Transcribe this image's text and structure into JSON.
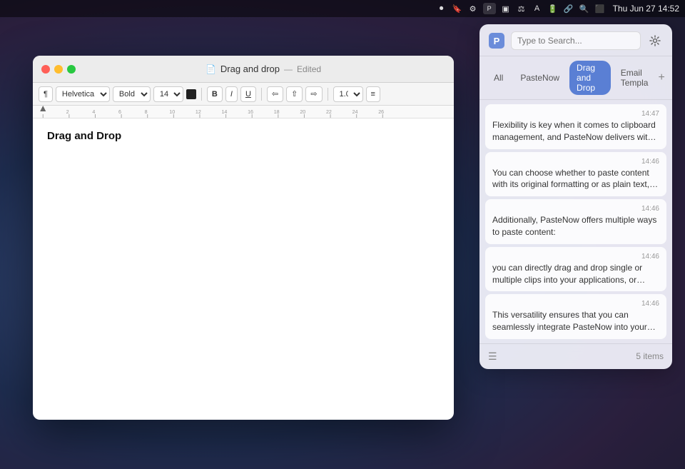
{
  "menubar": {
    "time": "Thu Jun 27  14:52",
    "icons": [
      "record",
      "bookmark",
      "gear",
      "paste-app",
      "media",
      "equalizer",
      "text",
      "battery",
      "link",
      "search",
      "airplay"
    ]
  },
  "editor": {
    "title": "Drag and drop",
    "separator": "—",
    "edited_label": "Edited",
    "heading": "Drag and Drop",
    "toolbar": {
      "paragraph_label": "¶",
      "font_name": "Helvetica",
      "font_weight": "Bold",
      "font_size": "14",
      "color_label": "",
      "bold": "B",
      "italic": "I",
      "underline": "U",
      "align_left": "≡",
      "align_center": "≡",
      "align_right": "≡",
      "line_spacing": "1.0",
      "list": "≡"
    }
  },
  "paste_panel": {
    "search_placeholder": "Type to Search...",
    "tabs": [
      {
        "id": "all",
        "label": "All",
        "active": false
      },
      {
        "id": "pastenow",
        "label": "PasteNow",
        "active": false
      },
      {
        "id": "drag-drop",
        "label": "Drag and Drop",
        "active": true
      },
      {
        "id": "email",
        "label": "Email Templa",
        "active": false
      }
    ],
    "add_label": "+",
    "clips": [
      {
        "time": "14:47",
        "text": "Flexibility is key when it comes to clipboard management, and PasteNow delivers with a varie..."
      },
      {
        "time": "14:46",
        "text": "You can choose whether to paste content with its original formatting or as plain text, depending on..."
      },
      {
        "time": "14:46",
        "text": "Additionally, PasteNow offers multiple ways to paste content:"
      },
      {
        "time": "14:46",
        "text": "you can directly drag and drop single or multiple clips into your applications, or summon the app..."
      },
      {
        "time": "14:46",
        "text": "This versatility ensures that you can seamlessly integrate PasteNow into your workflow, enhancin..."
      }
    ],
    "footer": {
      "items_count": "5 items",
      "list_icon": "☰"
    }
  }
}
